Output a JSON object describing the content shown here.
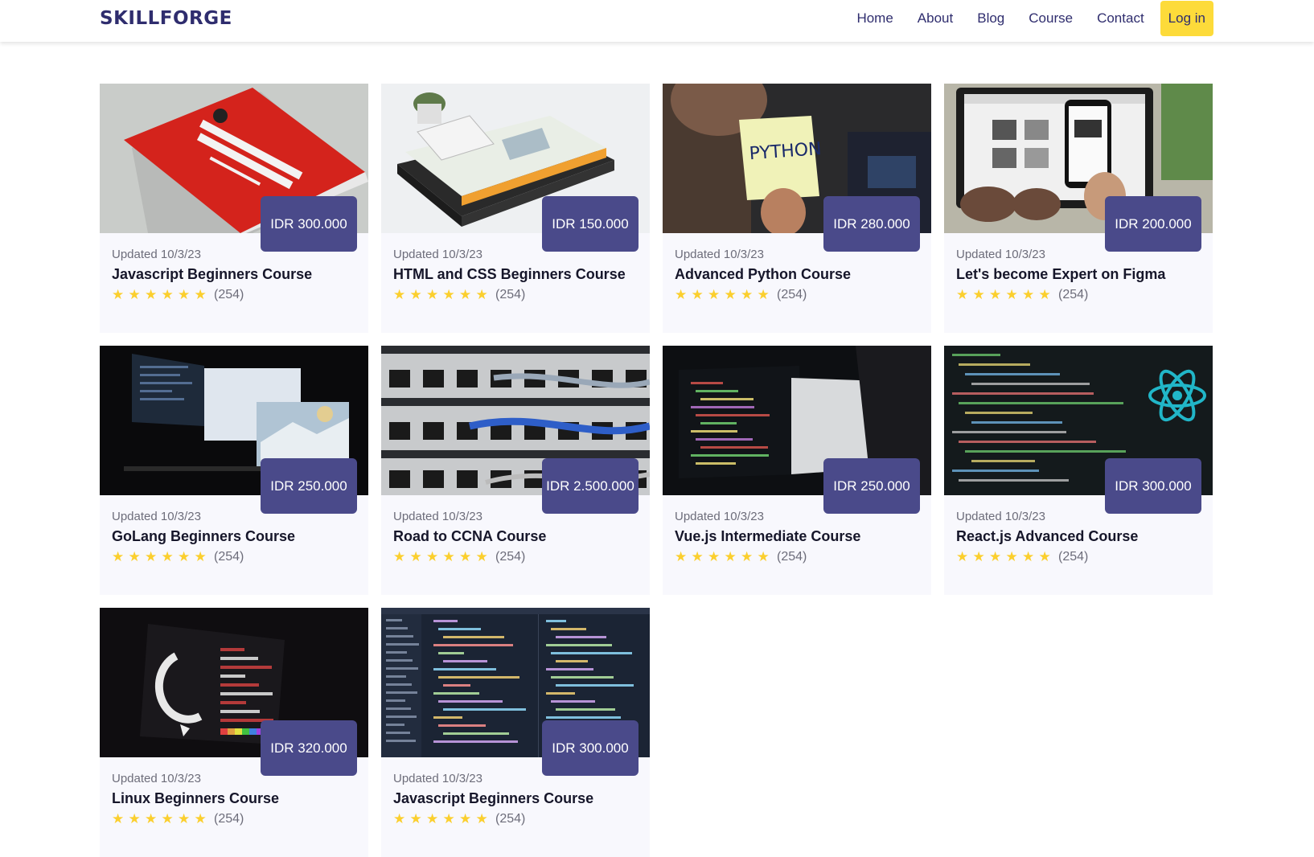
{
  "brand": {
    "logo_text": "SKILLFORGE"
  },
  "nav": {
    "items": [
      {
        "label": "Home"
      },
      {
        "label": "About"
      },
      {
        "label": "Blog"
      },
      {
        "label": "Course"
      },
      {
        "label": "Contact"
      }
    ],
    "login_label": "Log in"
  },
  "colors": {
    "primary": "#2f2d6e",
    "price_badge": "#4a4a8a",
    "accent_button": "#fddb3a",
    "star": "#fbcf2e",
    "card_bg": "#f8f8fd"
  },
  "courses": [
    {
      "price": "IDR 300.000",
      "updated": "Updated 10/3/23",
      "title": "Javascript Beginners Course",
      "rating_count": "(254)",
      "stars": 6,
      "image": "red-javascript-book"
    },
    {
      "price": "IDR 150.000",
      "updated": "Updated 10/3/23",
      "title": "HTML and CSS Beginners Course",
      "rating_count": "(254)",
      "stars": 6,
      "image": "css-books-with-phone"
    },
    {
      "price": "IDR 280.000",
      "updated": "Updated 10/3/23",
      "title": "Advanced Python Course",
      "rating_count": "(254)",
      "stars": 6,
      "image": "python-sticky-note"
    },
    {
      "price": "IDR 200.000",
      "updated": "Updated 10/3/23",
      "title": "Let's become Expert on Figma",
      "rating_count": "(254)",
      "stars": 6,
      "image": "laptop-and-phone-design"
    },
    {
      "price": "IDR 250.000",
      "updated": "Updated 10/3/23",
      "title": "GoLang Beginners Course",
      "rating_count": "(254)",
      "stars": 6,
      "image": "dark-desk-monitors"
    },
    {
      "price": "IDR 2.500.000",
      "updated": "Updated 10/3/23",
      "title": "Road to CCNA Course",
      "rating_count": "(254)",
      "stars": 6,
      "image": "network-patch-panel"
    },
    {
      "price": "IDR 250.000",
      "updated": "Updated 10/3/23",
      "title": "Vue.js Intermediate Course",
      "rating_count": "(254)",
      "stars": 6,
      "image": "dark-laptop-code"
    },
    {
      "price": "IDR 300.000",
      "updated": "Updated 10/3/23",
      "title": "React.js Advanced Course",
      "rating_count": "(254)",
      "stars": 6,
      "image": "react-logo-code"
    },
    {
      "price": "IDR 320.000",
      "updated": "Updated 10/3/23",
      "title": "Linux Beginners Course",
      "rating_count": "(254)",
      "stars": 6,
      "image": "debian-terminal"
    },
    {
      "price": "IDR 300.000",
      "updated": "Updated 10/3/23",
      "title": "Javascript Beginners Course",
      "rating_count": "(254)",
      "stars": 6,
      "image": "code-editor-screen"
    }
  ]
}
